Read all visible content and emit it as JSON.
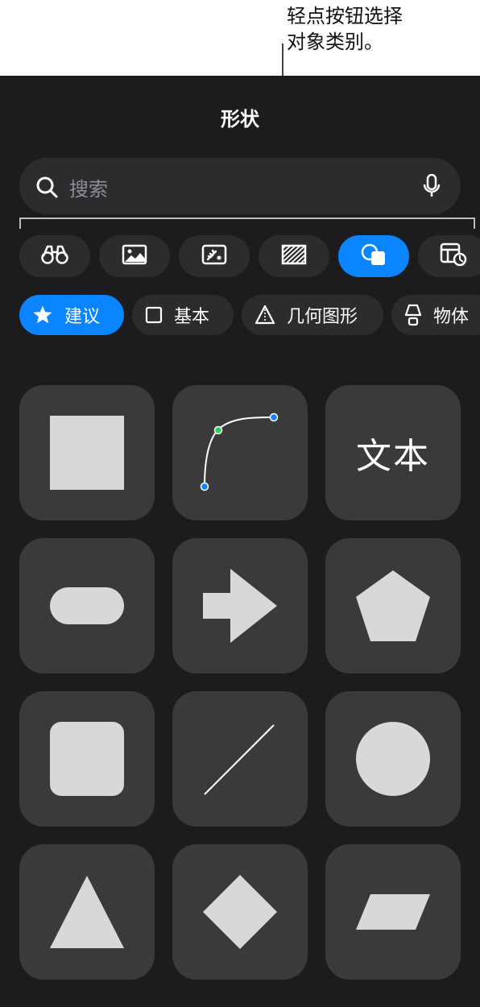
{
  "callout": {
    "text": "轻点按钮选择\n对象类别。"
  },
  "panel": {
    "title": "形状"
  },
  "search": {
    "placeholder": "搜索"
  },
  "categories": [
    {
      "icon": "binoculars-icon"
    },
    {
      "icon": "photo-icon"
    },
    {
      "icon": "sticker-icon"
    },
    {
      "icon": "pattern-icon"
    },
    {
      "icon": "shapes-icon",
      "selected": true
    },
    {
      "icon": "chart-icon"
    }
  ],
  "chips": [
    {
      "label": "建议",
      "icon": "star-icon",
      "selected": true
    },
    {
      "label": "基本",
      "icon": "square-outline-icon"
    },
    {
      "label": "几何图形",
      "icon": "pyramid-icon"
    },
    {
      "label": "物体",
      "icon": "lamp-icon"
    }
  ],
  "shapes": {
    "text_label": "文本"
  },
  "colors": {
    "panel_bg": "#1c1c1e",
    "accent": "#0a84ff",
    "tile_bg": "#3a3a3c",
    "shape_fill": "#d8d8d8"
  }
}
